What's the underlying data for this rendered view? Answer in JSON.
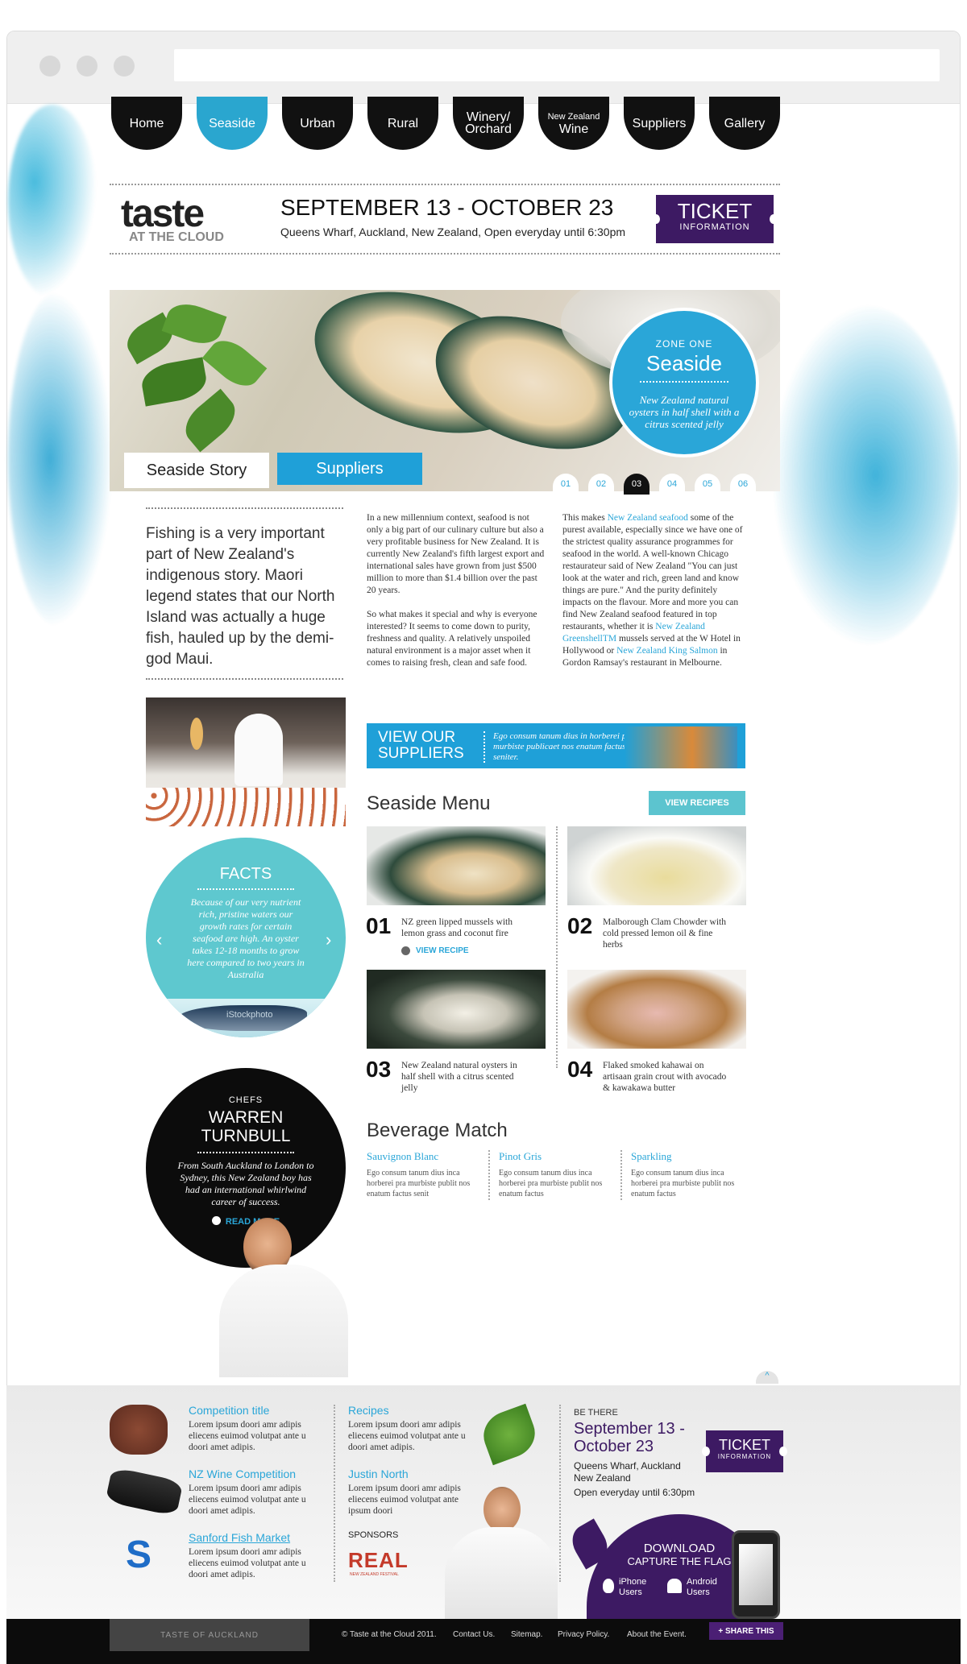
{
  "nav": {
    "items": [
      {
        "label": "Home"
      },
      {
        "label": "Seaside"
      },
      {
        "label": "Urban"
      },
      {
        "label": "Rural"
      },
      {
        "label": "Winery/ Orchard"
      },
      {
        "label_small": "New Zealand",
        "label": "Wine"
      },
      {
        "label": "Suppliers"
      },
      {
        "label": "Gallery"
      }
    ]
  },
  "header": {
    "logo_main": "taste",
    "logo_sub": "AT THE CLOUD",
    "date_title": "SEPTEMBER 13 - OCTOBER 23",
    "date_sub": "Queens Wharf, Auckland, New Zealand, Open everyday until 6:30pm",
    "ticket_big": "TICKET",
    "ticket_small": "INFORMATION"
  },
  "hero": {
    "zone_label": "ZONE ONE",
    "zone_title": "Seaside",
    "zone_text": "New Zealand natural oysters in half shell with a citrus scented jelly",
    "tabs": [
      "Seaside Story",
      "Suppliers"
    ],
    "pager": [
      "01",
      "02",
      "03",
      "04",
      "05",
      "06"
    ],
    "pager_active": "03"
  },
  "intro": "Fishing is a very important part of New Zealand's indigenous story. Maori legend states that our North Island was actually a huge fish, hauled up by the demi-god Maui.",
  "body_col1": [
    "In a new millennium context, seafood is not only a big part of our culinary culture but also a very profitable business for New Zealand. It is currently New Zealand's fifth largest export and international sales have grown from just $500 million to more than $1.4 billion over the past 20 years.",
    "So what makes it special and why is everyone interested? It seems to come down to purity, freshness and quality.  A relatively unspoiled natural environment is a major asset when it comes to raising fresh, clean and safe food."
  ],
  "body_col2": {
    "t1": "This makes ",
    "l1": "New Zealand seafood",
    "t2": " some of the purest available, especially since we have one of the strictest quality assurance programmes for seafood in the world. A well-known Chicago restaurateur said of New Zealand \"You can just look at the water and rich, green land and know things are pure.\" And the purity definitely impacts on the flavour. More and more you can find New Zealand seafood featured in top restaurants, whether it is ",
    "l2": "New Zealand GreenshellTM",
    "t3": " mussels served at the W Hotel in Hollywood or ",
    "l3": "New Zealand King Salmon",
    "t4": " in Gordon Ramsay's restaurant in Melbourne."
  },
  "suppliers_banner": {
    "title_line1": "VIEW OUR",
    "title_line2": "SUPPLIERS",
    "text": "Ego consum tanum dius in horberei pra murbiste publicaet nos enatum factus seniter."
  },
  "menu": {
    "title": "Seaside Menu",
    "view_recipes": "VIEW RECIPES",
    "items": [
      {
        "num": "01",
        "desc": "NZ green lipped mussels with lemon grass and coconut fire",
        "link": "VIEW RECIPE"
      },
      {
        "num": "02",
        "desc": "Malborough Clam Chowder with cold pressed lemon oil & fine herbs"
      },
      {
        "num": "03",
        "desc": "New Zealand natural oysters in half shell with a citrus scented jelly"
      },
      {
        "num": "04",
        "desc": "Flaked smoked kahawai on artisaan grain crout with avocado & kawakawa butter"
      }
    ]
  },
  "beverage": {
    "title": "Beverage Match",
    "items": [
      {
        "name": "Sauvignon Blanc",
        "text": "Ego consum tanum dius inca horberei pra murbiste publit nos enatum factus senit"
      },
      {
        "name": "Pinot Gris",
        "text": "Ego consum tanum dius inca horberei pra murbiste publit nos enatum factus"
      },
      {
        "name": "Sparkling",
        "text": "Ego consum tanum dius inca horberei pra murbiste publit nos enatum factus"
      }
    ]
  },
  "facts": {
    "title": "FACTS",
    "text": "Because of our very nutrient rich, pristine waters our growth rates for certain seafood are high. An oyster takes 12-18 months to grow here compared to two years in Australia",
    "watermark": "iStockphoto"
  },
  "chef": {
    "label": "CHEFS",
    "name_line1": "WARREN",
    "name_line2": "TURNBULL",
    "text": "From South Auckland to London to Sydney, this New Zealand boy has had an international whirlwind career of success.",
    "read_more": "READ MORE"
  },
  "footer": {
    "col1": [
      {
        "title": "Competition title",
        "text": "Lorem ipsum doori amr adipis eliecens euimod volutpat ante u doori amet adipis."
      },
      {
        "title": "NZ Wine Competition",
        "text": "Lorem ipsum doori amr adipis eliecens euimod volutpat ante u doori amet adipis."
      },
      {
        "title": "Sanford Fish Market",
        "text": "Lorem ipsum doori amr adipis eliecens euimod volutpat ante u doori amet adipis."
      }
    ],
    "col2": [
      {
        "title": "Recipes",
        "text": "Lorem ipsum doori amr adipis eliecens euimod volutpat ante u doori amet adipis."
      },
      {
        "title": "Justin North",
        "text": "Lorem ipsum doori amr adipis eliecens euimod volutpat ante ipsum doori"
      }
    ],
    "sponsors_label": "SPONSORS",
    "sponsor_logo": "REAL",
    "sponsor_sub": "NEW ZEALAND FESTIVAL",
    "be_there": {
      "label": "BE THERE",
      "date_line1": "September 13 -",
      "date_line2": "October 23",
      "place": "Queens Wharf, Auckland New Zealand",
      "open": "Open everyday until 6:30pm",
      "ticket_big": "TICKET",
      "ticket_small": "INFORMATION"
    },
    "download": {
      "line1": "DOWNLOAD",
      "line2": "CAPTURE THE FLAG",
      "iphone": "iPhone Users",
      "android": "Android Users"
    }
  },
  "bottom_bar": {
    "box": "TASTE OF AUCKLAND",
    "copyright": "© Taste at the Cloud 2011.",
    "links": [
      "Contact Us.",
      "Sitemap.",
      "Privacy Policy.",
      "About the Event."
    ],
    "share": "+ SHARE THIS"
  },
  "colors": {
    "accent": "#2aa6d8",
    "purple": "#3d1a63",
    "teal": "#5ec8cf"
  }
}
